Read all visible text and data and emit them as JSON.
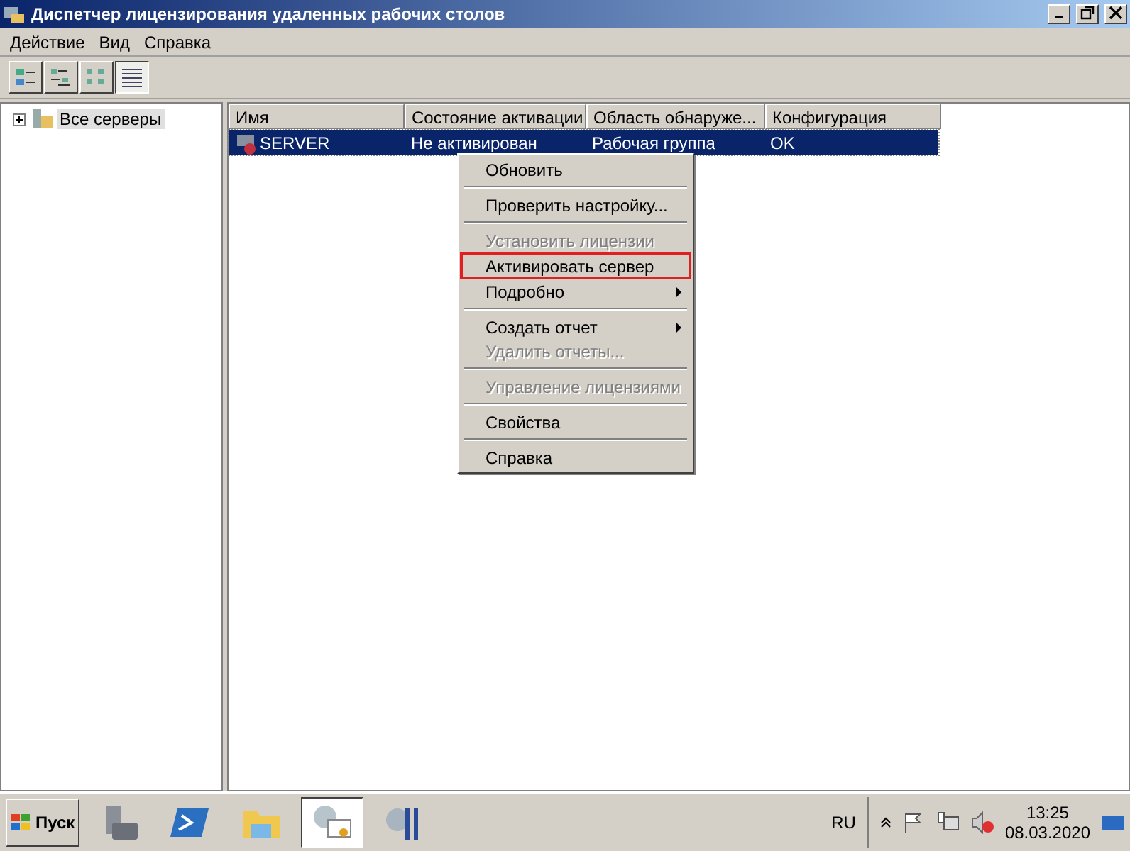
{
  "window": {
    "title": "Диспетчер лицензирования удаленных рабочих столов"
  },
  "menu_bar": [
    "Действие",
    "Вид",
    "Справка"
  ],
  "toolbar": [
    {
      "selected": false
    },
    {
      "selected": false
    },
    {
      "selected": false
    },
    {
      "selected": true
    }
  ],
  "tree": [
    {
      "label": "Все серверы",
      "expanded": false,
      "selected": true
    }
  ],
  "table": {
    "columns": [
      "Имя",
      "Состояние активации",
      "Область обнаруже...",
      "Конфигурация"
    ],
    "rows": [
      {
        "cells": [
          "SERVER",
          "Не активирован",
          "Рабочая группа",
          "OK"
        ],
        "selected": true
      }
    ]
  },
  "context_menu": [
    {
      "kind": "item",
      "label": "Обновить",
      "disabled": false,
      "submenu": false,
      "outlined": false
    },
    {
      "kind": "separator"
    },
    {
      "kind": "item",
      "label": "Проверить настройку...",
      "disabled": false,
      "submenu": false,
      "outlined": false
    },
    {
      "kind": "separator"
    },
    {
      "kind": "item",
      "label": "Установить лицензии",
      "disabled": true,
      "submenu": false,
      "outlined": false
    },
    {
      "kind": "item",
      "label": "Активировать сервер",
      "disabled": false,
      "submenu": false,
      "outlined": true
    },
    {
      "kind": "item",
      "label": "Подробно",
      "disabled": false,
      "submenu": true,
      "outlined": false
    },
    {
      "kind": "separator"
    },
    {
      "kind": "item",
      "label": "Создать отчет",
      "disabled": false,
      "submenu": true,
      "outlined": false
    },
    {
      "kind": "item",
      "label": "Удалить отчеты...",
      "disabled": true,
      "submenu": false,
      "outlined": false
    },
    {
      "kind": "separator"
    },
    {
      "kind": "item",
      "label": "Управление лицензиями",
      "disabled": true,
      "submenu": false,
      "outlined": false
    },
    {
      "kind": "separator"
    },
    {
      "kind": "item",
      "label": "Свойства",
      "disabled": false,
      "submenu": false,
      "outlined": false
    },
    {
      "kind": "separator"
    },
    {
      "kind": "item",
      "label": "Справка",
      "disabled": false,
      "submenu": false,
      "outlined": false
    }
  ],
  "taskbar": {
    "start": "Пуск",
    "apps": [
      {
        "selected": false
      },
      {
        "selected": false
      },
      {
        "selected": false
      },
      {
        "selected": true
      },
      {
        "selected": false
      }
    ],
    "language": "RU",
    "time": "13:25",
    "date": "08.03.2020"
  }
}
